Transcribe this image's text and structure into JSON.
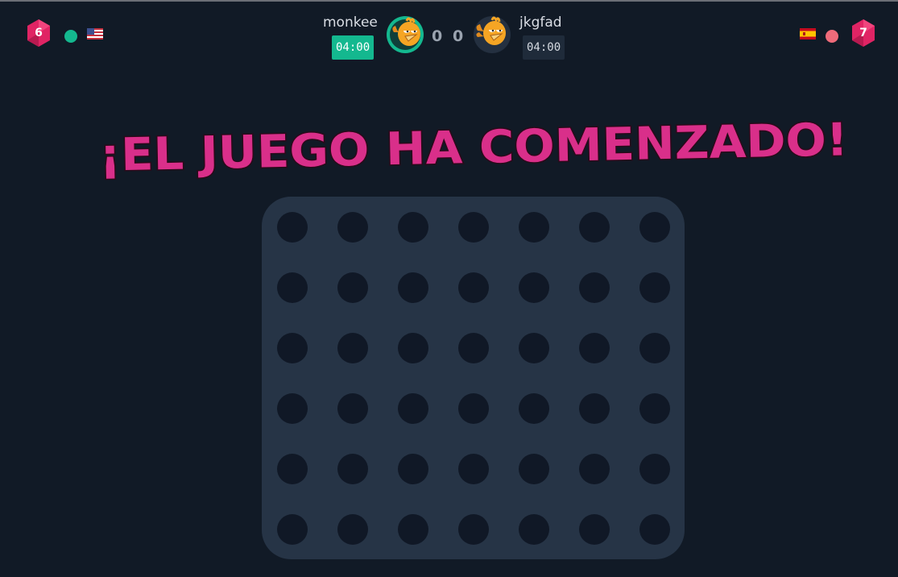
{
  "players": {
    "left": {
      "name": "monkee",
      "level": "6",
      "timer": "04:00",
      "status_color": "#14b88f",
      "flag": "us-flag"
    },
    "right": {
      "name": "jkgfad",
      "level": "7",
      "timer": "04:00",
      "status_color": "#ef6b7a",
      "flag": "es-flag"
    }
  },
  "score": {
    "left": "0",
    "right": "0"
  },
  "title": "¡EL JUEGO HA COMENZADO!",
  "board": {
    "columns": 7,
    "rows": 6
  },
  "colors": {
    "background": "#111a26",
    "board": "#263446",
    "slot": "#101826",
    "title": "#d92f8a",
    "badge": "#e02464",
    "timer_active": "#14b88f",
    "timer_inactive": "#1f2b3a"
  }
}
